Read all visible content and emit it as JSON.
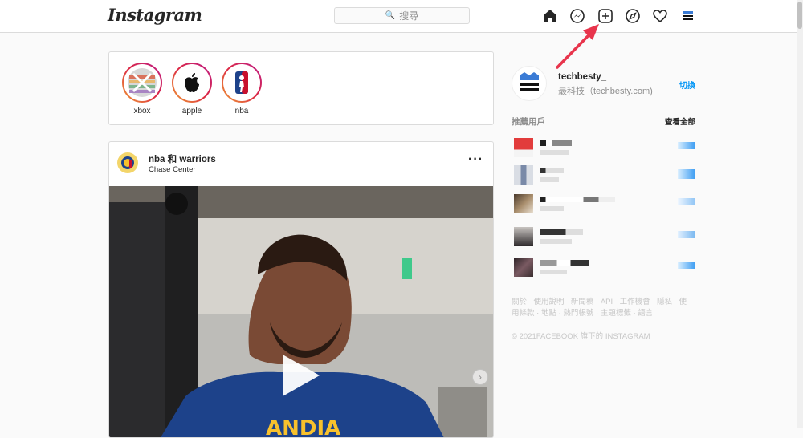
{
  "header": {
    "logo_text": "Instagram",
    "search_placeholder": "搜尋",
    "search_glyph": "🔍"
  },
  "nav_icons": [
    "home-icon",
    "messenger-icon",
    "new-post-icon",
    "explore-icon",
    "activity-heart-icon",
    "profile-avatar"
  ],
  "stories": [
    {
      "name": "xbox"
    },
    {
      "name": "apple"
    },
    {
      "name": "nba"
    }
  ],
  "post": {
    "user": "nba 和 warriors",
    "location": "Chase Center",
    "more_label": "···"
  },
  "profile": {
    "username": "techbesty_",
    "display_name": "最科技（techbesty.com)",
    "switch_label": "切換"
  },
  "suggestions": {
    "title": "推薦用戶",
    "see_all": "查看全部"
  },
  "footer": {
    "links": "關於 · 使用說明 · 新聞稿 · API · 工作機會 · 隱私 · 使用條款 · 地點 · 熱門帳號 · 主題標籤 · 語言",
    "copyright": "© 2021FACEBOOK 旗下的 INSTAGRAM"
  },
  "colors": {
    "accent": "#0095f6",
    "annotation_arrow": "#e8344c"
  }
}
